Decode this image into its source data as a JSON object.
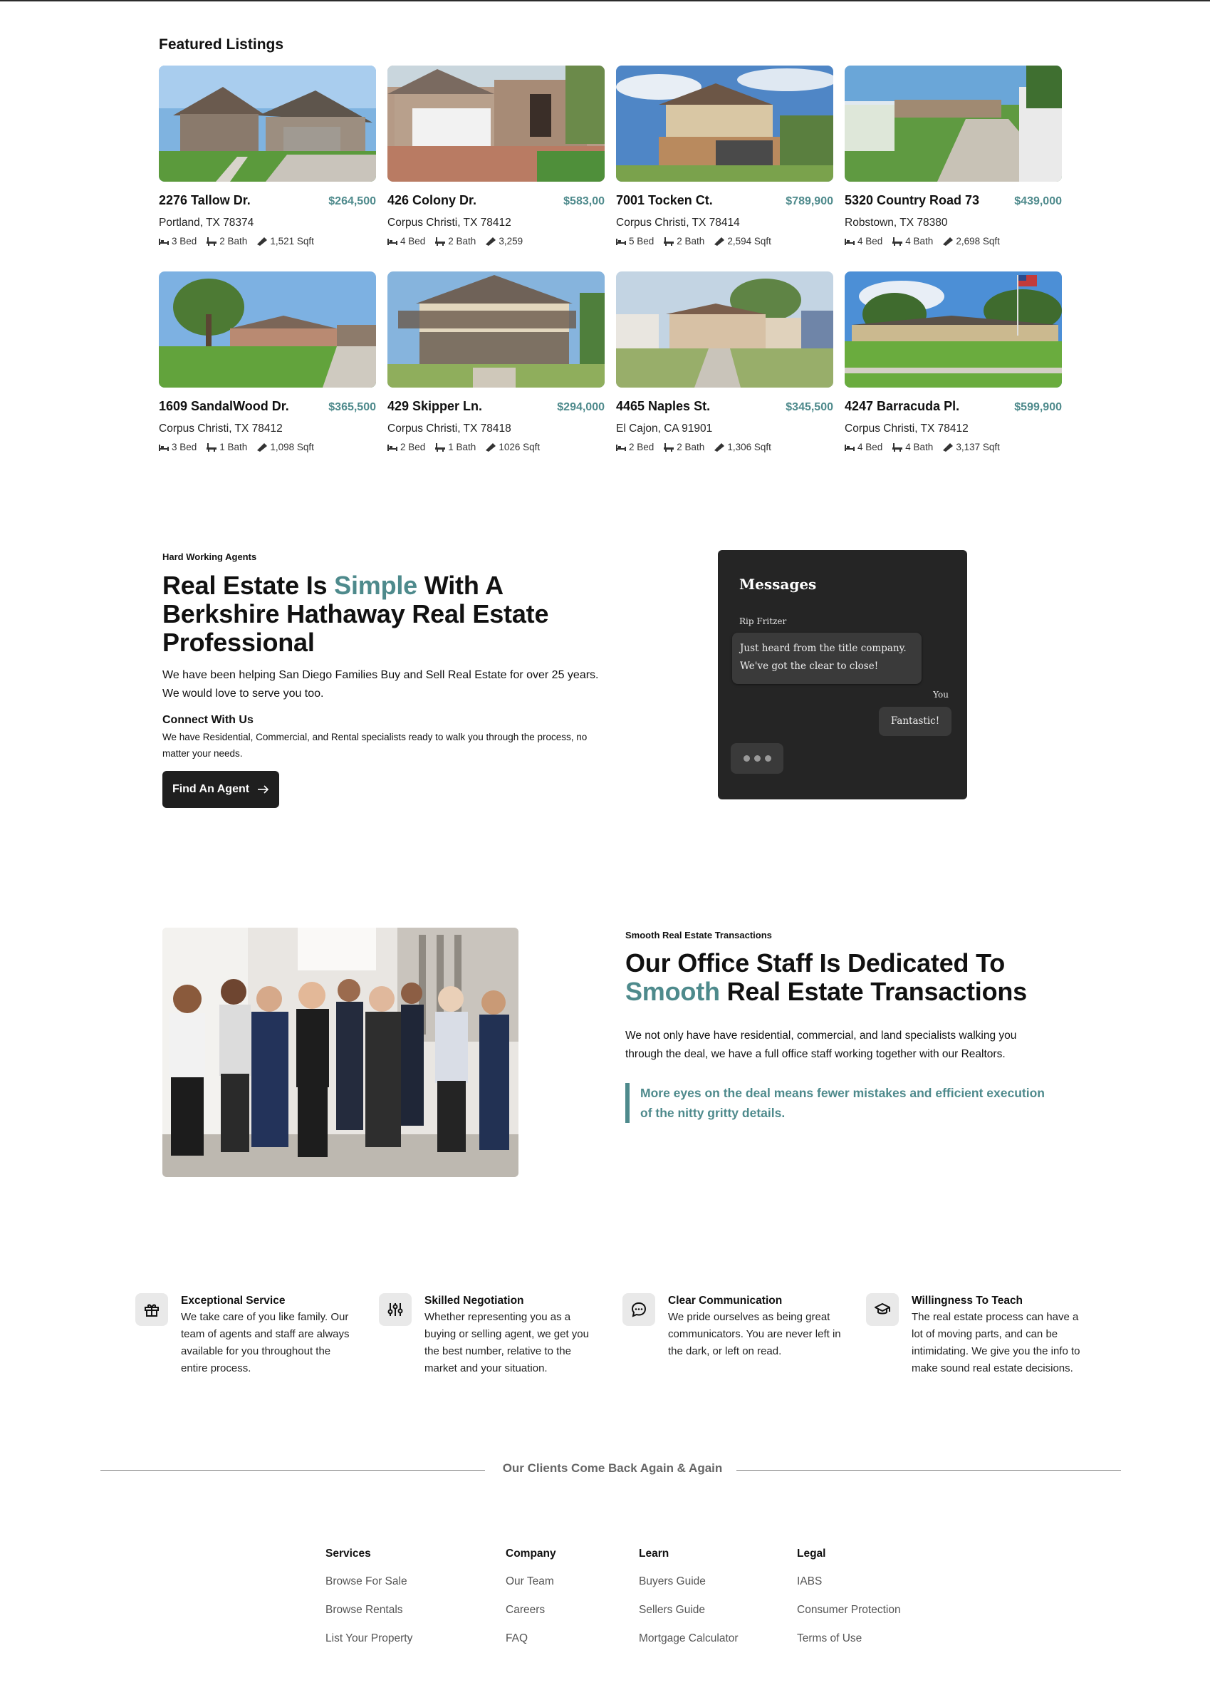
{
  "featured": {
    "title": "Featured Listings",
    "listings": [
      {
        "address": "2276 Tallow Dr.",
        "price": "$264,500",
        "city": "Portland, TX 78374",
        "beds": "3 Bed",
        "baths": "2 Bath",
        "sqft": "1,521 Sqft"
      },
      {
        "address": "426 Colony Dr.",
        "price": "$583,00",
        "city": "Corpus Christi, TX 78412",
        "beds": "4 Bed",
        "baths": "2 Bath",
        "sqft": "3,259"
      },
      {
        "address": "7001 Tocken Ct.",
        "price": "$789,900",
        "city": "Corpus Christi, TX 78414",
        "beds": "5 Bed",
        "baths": "2 Bath",
        "sqft": "2,594 Sqft"
      },
      {
        "address": "5320 Country Road 73",
        "price": "$439,000",
        "city": "Robstown, TX 78380",
        "beds": "4 Bed",
        "baths": "4 Bath",
        "sqft": "2,698 Sqft"
      },
      {
        "address": "1609 SandalWood Dr.",
        "price": "$365,500",
        "city": "Corpus Christi, TX 78412",
        "beds": "3 Bed",
        "baths": "1 Bath",
        "sqft": "1,098 Sqft"
      },
      {
        "address": "429 Skipper Ln.",
        "price": "$294,000",
        "city": "Corpus Christi, TX 78418",
        "beds": "2 Bed",
        "baths": "1 Bath",
        "sqft": "1026 Sqft"
      },
      {
        "address": "4465 Naples St.",
        "price": "$345,500",
        "city": "El Cajon, CA 91901",
        "beds": "2 Bed",
        "baths": "2 Bath",
        "sqft": "1,306 Sqft"
      },
      {
        "address": "4247 Barracuda Pl.",
        "price": "$599,900",
        "city": "Corpus Christi, TX 78412",
        "beds": "4 Bed",
        "baths": "4 Bath",
        "sqft": "3,137 Sqft"
      }
    ]
  },
  "agents": {
    "eyebrow": "Hard Working Agents",
    "heading_pre": "Real Estate Is ",
    "heading_accent": "Simple",
    "heading_post": " With A Berkshire Hathaway Real Estate Professional",
    "para": "We have been helping San Diego Families Buy and Sell Real Estate for over 25 years. We would love to serve you too.",
    "connect_title": "Connect With Us",
    "connect_text": "We have Residential, Commercial, and Rental specialists ready to walk you through the process, no matter your needs.",
    "button_label": "Find An Agent"
  },
  "messages": {
    "title": "Messages",
    "sender": "Rip Fritzer",
    "incoming": "Just heard from the title company. We've got the clear to close!",
    "you_label": "You",
    "outgoing": "Fantastic!"
  },
  "staff": {
    "eyebrow": "Smooth Real Estate Transactions",
    "heading_pre": "Our Office Staff Is Dedicated To ",
    "heading_accent": "Smooth",
    "heading_post": " Real Estate Transactions",
    "para": "We not only have have residential, commercial, and land specialists walking you through the deal, we have a full office staff working together with our Realtors.",
    "quote": "More eyes on the deal means fewer mistakes and efficient execution of the nitty gritty details."
  },
  "features": [
    {
      "icon": "gift-icon",
      "title": "Exceptional Service",
      "text": "We take care of you like family. Our team of agents and staff are always available for you throughout the entire process."
    },
    {
      "icon": "sliders-icon",
      "title": "Skilled Negotiation",
      "text": "Whether representing you as a buying or selling agent, we get you the best number, relative to the market and your situation."
    },
    {
      "icon": "chat-icon",
      "title": "Clear Communication",
      "text": "We pride ourselves as being great communicators. You are never left in the dark, or left on read."
    },
    {
      "icon": "graduation-cap-icon",
      "title": "Willingness To Teach",
      "text": "The real estate process can have a lot of moving parts, and can be intimidating. We give you the info to make sound real estate decisions."
    }
  ],
  "divider": {
    "text": "Our Clients Come Back Again & Again"
  },
  "footer": {
    "columns": [
      {
        "title": "Services",
        "links": [
          "Browse For Sale",
          "Browse Rentals",
          "List Your Property"
        ]
      },
      {
        "title": "Company",
        "links": [
          "Our Team",
          "Careers",
          "FAQ"
        ]
      },
      {
        "title": "Learn",
        "links": [
          "Buyers Guide",
          "Sellers Guide",
          "Mortgage Calculator"
        ]
      },
      {
        "title": "Legal",
        "links": [
          "IABS",
          "Consumer Protection",
          "Terms of Use"
        ]
      }
    ]
  },
  "colors": {
    "accent": "#4e8a8c",
    "dark": "#1f1f1f",
    "chat_bg": "#252525"
  }
}
